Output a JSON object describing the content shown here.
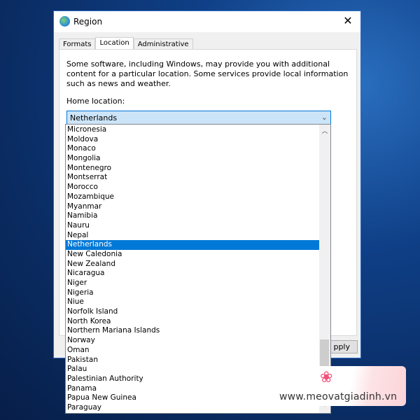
{
  "window": {
    "title": "Region",
    "close_icon": "close-icon"
  },
  "tabs": [
    {
      "label": "Formats"
    },
    {
      "label": "Location",
      "active": true
    },
    {
      "label": "Administrative"
    }
  ],
  "description": "Some software, including Windows, may provide you with additional content for a particular location. Some services provide local information such as news and weather.",
  "home_location_label": "Home location:",
  "combo": {
    "value": "Netherlands"
  },
  "apply_label": "pply",
  "list": {
    "items": [
      "Micronesia",
      "Moldova",
      "Monaco",
      "Mongolia",
      "Montenegro",
      "Montserrat",
      "Morocco",
      "Mozambique",
      "Myanmar",
      "Namibia",
      "Nauru",
      "Nepal",
      "Netherlands",
      "New Caledonia",
      "New Zealand",
      "Nicaragua",
      "Niger",
      "Nigeria",
      "Niue",
      "Norfolk Island",
      "North Korea",
      "Northern Mariana Islands",
      "Norway",
      "Oman",
      "Pakistan",
      "Palau",
      "Palestinian Authority",
      "Panama",
      "Papua New Guinea",
      "Paraguay"
    ],
    "selected": "Netherlands",
    "scroll_position_percent": 86
  },
  "watermark": {
    "text": "www.meovatgiadinh.vn"
  },
  "colors": {
    "selection": "#0078d7",
    "combo_bg": "#cce4f7",
    "watermark_pink": "#f0507a"
  }
}
